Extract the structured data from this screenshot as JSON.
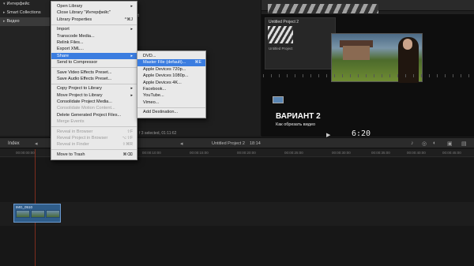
{
  "sidebar": {
    "items": [
      {
        "label": "Интерфейс",
        "tri": "▾"
      },
      {
        "label": "Smart Collections",
        "tri": "▸"
      },
      {
        "label": "Видео",
        "tri": "▸"
      }
    ]
  },
  "browser": {
    "status": "f 3 selected, 01:11:62",
    "top_text": "ct"
  },
  "viewer": {
    "project_title": "Untitled Project 2",
    "project_thumb_label": "Untitled Project",
    "caption_title": "ВАРИАНТ 2",
    "caption_subtitle": "Как обрезать видео",
    "timecode": "6:20",
    "play_glyph": "▶"
  },
  "main_menu": {
    "items": [
      {
        "label": "Open Library",
        "shortcut": "▸",
        "disabled": false
      },
      {
        "label": "Close Library \"Интерфейс\"",
        "shortcut": "",
        "disabled": false
      },
      {
        "label": "Library Properties",
        "shortcut": "^⌘J",
        "disabled": false
      },
      {
        "sep": true
      },
      {
        "label": "Import",
        "shortcut": "▸",
        "disabled": false
      },
      {
        "label": "Transcode Media...",
        "shortcut": "",
        "disabled": false
      },
      {
        "label": "Relink Files...",
        "shortcut": "",
        "disabled": false
      },
      {
        "label": "Export XML...",
        "shortcut": "",
        "disabled": false
      },
      {
        "label": "Share",
        "shortcut": "▸",
        "disabled": false,
        "highlighted": true
      },
      {
        "label": "Send to Compressor",
        "shortcut": "",
        "disabled": false
      },
      {
        "sep": true
      },
      {
        "label": "Save Video Effects Preset...",
        "shortcut": "",
        "disabled": false
      },
      {
        "label": "Save Audio Effects Preset...",
        "shortcut": "",
        "disabled": false
      },
      {
        "sep": true
      },
      {
        "label": "Copy Project to Library",
        "shortcut": "▸",
        "disabled": false
      },
      {
        "label": "Move Project to Library",
        "shortcut": "▸",
        "disabled": false
      },
      {
        "label": "Consolidate Project Media...",
        "shortcut": "",
        "disabled": false
      },
      {
        "label": "Consolidate Motion Content...",
        "shortcut": "",
        "disabled": true
      },
      {
        "label": "Delete Generated Project Files...",
        "shortcut": "",
        "disabled": false
      },
      {
        "label": "Merge Events",
        "shortcut": "",
        "disabled": true
      },
      {
        "sep": true
      },
      {
        "label": "Reveal in Browser",
        "shortcut": "⇧F",
        "disabled": true
      },
      {
        "label": "Reveal Project in Browser",
        "shortcut": "⌥⇧F",
        "disabled": true
      },
      {
        "label": "Reveal in Finder",
        "shortcut": "⇧⌘R",
        "disabled": true
      },
      {
        "sep": true
      },
      {
        "label": "Move to Trash",
        "shortcut": "⌘⌫",
        "disabled": false
      }
    ]
  },
  "share_menu": {
    "items": [
      {
        "label": "DVD...",
        "shortcut": "",
        "highlighted": false
      },
      {
        "label": "Master File (default)...",
        "shortcut": "⌘E",
        "highlighted": true
      },
      {
        "label": "Apple Devices 720p...",
        "shortcut": "",
        "highlighted": false
      },
      {
        "label": "Apple Devices 1080p...",
        "shortcut": "",
        "highlighted": false
      },
      {
        "label": "Apple Devices 4K...",
        "shortcut": "",
        "highlighted": false
      },
      {
        "label": "Facebook...",
        "shortcut": "",
        "highlighted": false
      },
      {
        "label": "YouTube...",
        "shortcut": "",
        "highlighted": false
      },
      {
        "label": "Vimeo...",
        "shortcut": "",
        "highlighted": false
      },
      {
        "sep": true
      },
      {
        "label": "Add Destination...",
        "shortcut": "",
        "highlighted": false
      }
    ]
  },
  "timeline": {
    "index_label": "Index",
    "project_name": "Untitled Project 2",
    "duration": "18:14",
    "clip_label": "IMG_0510",
    "ruler_ticks": [
      "00:00:00:00",
      "00:00:05:00",
      "00:00:10:00",
      "00:00:15:00",
      "00:00:20:00",
      "00:00:25:00",
      "00:00:30:00",
      "00:00:35:00",
      "00:00:40:00",
      "00:00:45:00"
    ]
  },
  "colors": {
    "menu_highlight": "#3b7de0",
    "playhead": "#c23b22",
    "clip": "#2f5d8a"
  }
}
